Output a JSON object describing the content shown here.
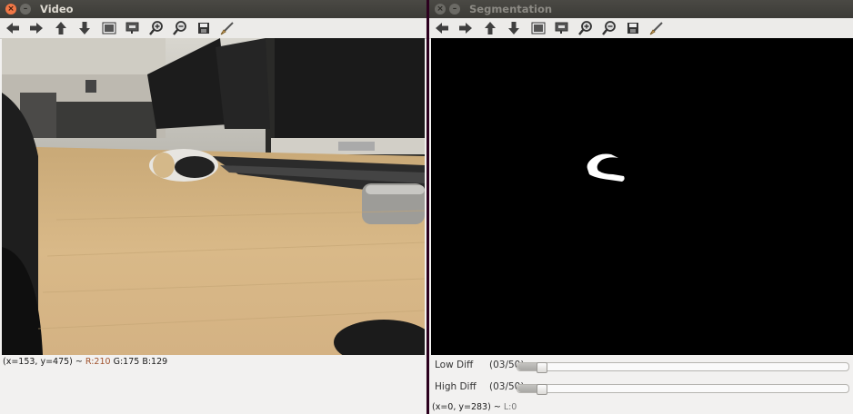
{
  "video_window": {
    "title": "Video",
    "status": {
      "coords": "(x=153, y=475) ~",
      "r": "R:210",
      "g": "G:175",
      "b": "B:129"
    }
  },
  "segmentation_window": {
    "title": "Segmentation",
    "trackbars": [
      {
        "label": "Low Diff",
        "value_text": "(03/50)",
        "value": 3,
        "max": 50
      },
      {
        "label": "High Diff",
        "value_text": "(03/50)",
        "value": 3,
        "max": 50
      }
    ],
    "status": {
      "coords": "(x=0, y=283) ~",
      "l": "L:0"
    }
  },
  "toolbar_icons": [
    "arrow-left-icon",
    "arrow-right-icon",
    "arrow-up-icon",
    "arrow-down-icon",
    "zoom-fit-icon",
    "zoom-region-icon",
    "zoom-in-icon",
    "zoom-out-icon",
    "save-icon",
    "properties-icon"
  ],
  "colors": {
    "window_bg": "#f2f1f0",
    "titlebar": "#3c3b37",
    "close_button": "#f07746",
    "desktop": "#2c001e"
  }
}
